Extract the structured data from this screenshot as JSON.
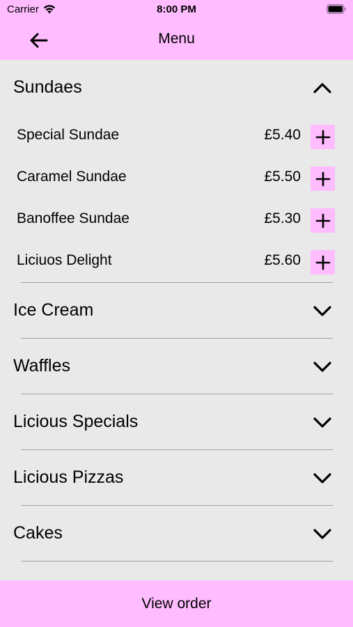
{
  "status_bar": {
    "carrier": "Carrier",
    "time": "8:00 PM"
  },
  "nav": {
    "title": "Menu",
    "back_icon": "arrow-left-icon"
  },
  "sections": [
    {
      "title": "Sundaes",
      "expanded": true,
      "items": [
        {
          "name": "Special Sundae",
          "price": "£5.40"
        },
        {
          "name": "Caramel Sundae",
          "price": "£5.50"
        },
        {
          "name": "Banoffee Sundae",
          "price": "£5.30"
        },
        {
          "name": "Liciuos Delight",
          "price": "£5.60"
        }
      ]
    },
    {
      "title": "Ice Cream",
      "expanded": false
    },
    {
      "title": "Waffles",
      "expanded": false
    },
    {
      "title": "Licious Specials",
      "expanded": false
    },
    {
      "title": "Licious Pizzas",
      "expanded": false
    },
    {
      "title": "Cakes",
      "expanded": false
    }
  ],
  "footer": {
    "view_order_label": "View order"
  },
  "colors": {
    "accent_pink": "#ffbcff",
    "background": "#e9e9ea",
    "divider": "#a0a0a2"
  }
}
